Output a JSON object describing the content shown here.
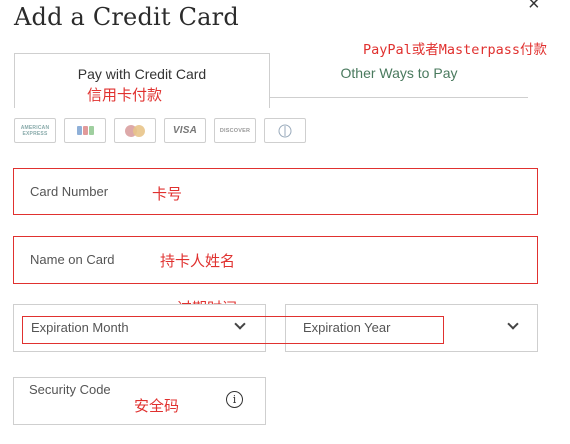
{
  "dialog": {
    "title": "Add a Credit Card",
    "close_symbol": "×"
  },
  "tabs": {
    "active_label": "Pay with Credit Card",
    "other_label": "Other Ways to Pay"
  },
  "annotations": {
    "other_ways": "PayPal或者Masterpass付款",
    "credit_card": "信用卡付款",
    "card_number": "卡号",
    "name_on_card": "持卡人姓名",
    "expiration": "过期时间",
    "security_code": "安全码"
  },
  "card_brands": [
    {
      "name": "amex-icon",
      "text": "AMERICAN EXPRESS"
    },
    {
      "name": "jcb-icon",
      "text": ""
    },
    {
      "name": "mastercard-icon",
      "text": ""
    },
    {
      "name": "visa-icon",
      "text": "VISA"
    },
    {
      "name": "discover-icon",
      "text": "DISCOVER"
    },
    {
      "name": "diners-club-icon",
      "text": ""
    }
  ],
  "form": {
    "card_number_label": "Card Number",
    "name_on_card_label": "Name on Card",
    "expiration_month_label": "Expiration Month",
    "expiration_year_label": "Expiration Year",
    "security_code_label": "Security Code",
    "info_symbol": "i"
  },
  "colors": {
    "annotation": "#e0312f",
    "tab_link": "#4a7a5e",
    "border": "#cfcfcf"
  }
}
